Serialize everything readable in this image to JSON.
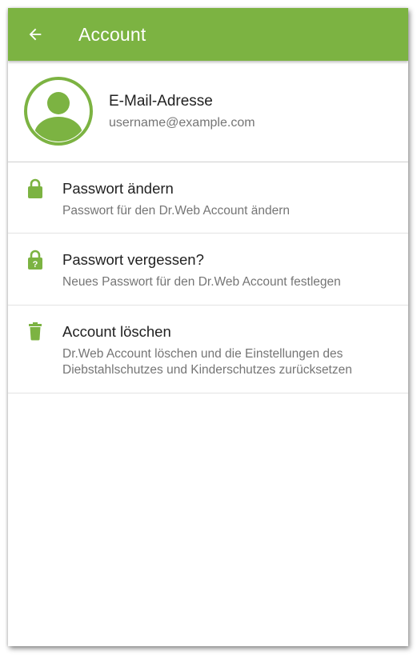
{
  "colors": {
    "accent": "#7cb342",
    "title_text": "#212121",
    "secondary_text": "#757575"
  },
  "appbar": {
    "back_icon": "arrow-left-icon",
    "title": "Account"
  },
  "account": {
    "avatar_icon": "user-avatar-icon",
    "label": "E-Mail-Adresse",
    "email": "username@example.com"
  },
  "menu": {
    "items": [
      {
        "icon": "lock-icon",
        "title": "Passwort ändern",
        "subtitle": "Passwort für den Dr.Web Account ändern"
      },
      {
        "icon": "lock-question-icon",
        "title": "Passwort vergessen?",
        "subtitle": "Neues Passwort für den Dr.Web Account festlegen"
      },
      {
        "icon": "trash-icon",
        "title": "Account löschen",
        "subtitle_line1": "Dr.Web Account löschen und die Einstellungen des",
        "subtitle_line2": "Diebstahlschutzes und Kinderschutzes zurücksetzen"
      }
    ]
  }
}
